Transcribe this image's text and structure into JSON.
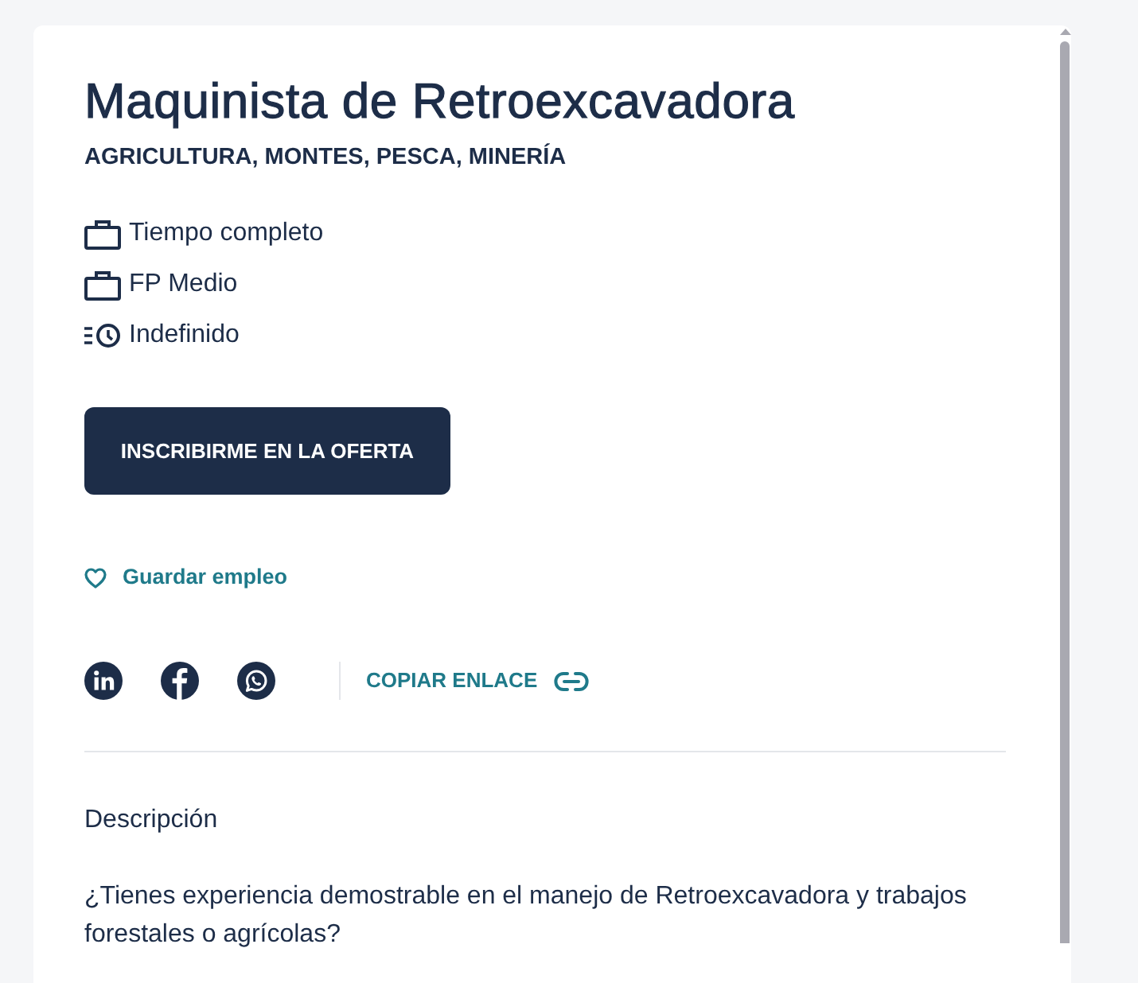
{
  "job": {
    "title": "Maquinista de Retroexcavadora",
    "category": "AGRICULTURA, MONTES, PESCA, MINERÍA"
  },
  "features": [
    {
      "kind": "briefcase",
      "label": "Tiempo completo"
    },
    {
      "kind": "briefcase",
      "label": "FP Medio"
    },
    {
      "kind": "clock",
      "label": "Indefinido"
    }
  ],
  "apply_button": {
    "label": "INSCRIBIRME EN LA OFERTA"
  },
  "save_link": {
    "label": "Guardar empleo",
    "saved": false
  },
  "share": {
    "copy_link": "COPIAR ENLACE"
  },
  "description": {
    "heading": "Descripción",
    "text": "¿Tienes experiencia demostrable en el manejo de Retroexcavadora y trabajos forestales o agrícolas?"
  }
}
